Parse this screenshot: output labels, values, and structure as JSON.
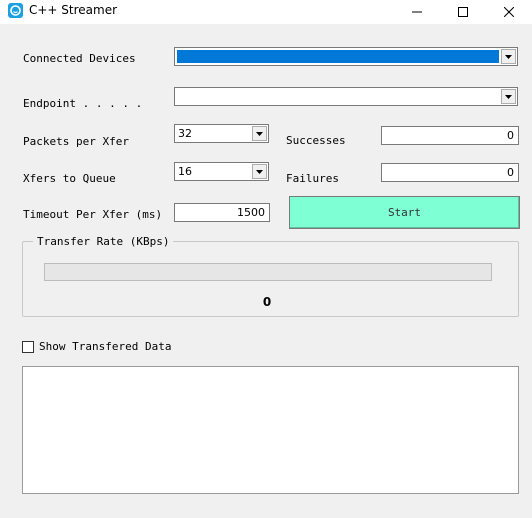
{
  "window": {
    "title": "C++ Streamer",
    "app_icon": "app-icon",
    "controls": [
      "minimize-icon",
      "maximize-icon",
      "close-icon"
    ]
  },
  "form": {
    "connected_devices_label": "Connected Devices",
    "connected_devices_value": "",
    "endpoint_label": "Endpoint . . . . .",
    "endpoint_value": "",
    "packets_label": "Packets per Xfer",
    "packets_value": "32",
    "xfers_label": "Xfers to Queue",
    "xfers_value": "16",
    "timeout_label": "Timeout Per Xfer (ms)",
    "timeout_value": "1500",
    "successes_label": "Successes",
    "successes_value": "0",
    "failures_label": "Failures",
    "failures_value": "0",
    "start_label": "Start"
  },
  "transfer_rate": {
    "label": "Transfer Rate (KBps)",
    "value": "0",
    "progress": 0
  },
  "show_data": {
    "label": "Show Transfered Data",
    "checked": false
  },
  "colors": {
    "accent_selection": "#0078d7",
    "start_button": "#7fffd4"
  }
}
